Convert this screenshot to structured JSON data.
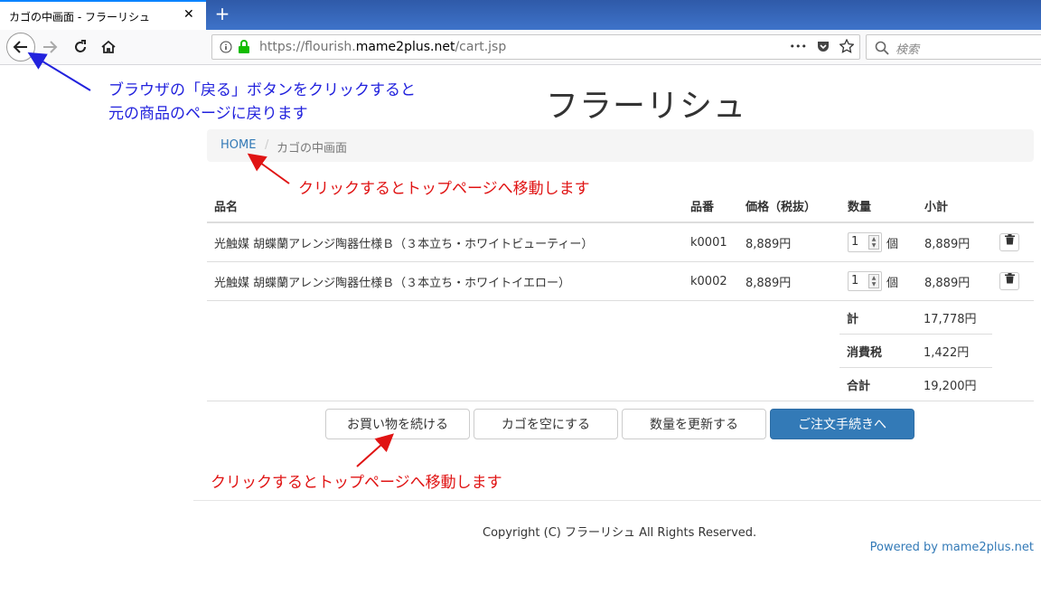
{
  "browser": {
    "tab_title": "カゴの中画面 - フラーリシュ",
    "tab_close": "✕",
    "new_tab": "+",
    "url_prefix": "https://flourish.",
    "url_domain": "mame2plus.net",
    "url_path": "/cart.jsp",
    "search_placeholder": "検索",
    "menu_dots": "•••"
  },
  "site": {
    "title": "フラーリシュ"
  },
  "breadcrumb": {
    "home": "HOME",
    "sep": "/",
    "current": "カゴの中画面"
  },
  "cart": {
    "headers": [
      "品名",
      "品番",
      "価格（税抜）",
      "数量",
      "小計"
    ],
    "rows": [
      {
        "name": "光触媒 胡蝶蘭アレンジ陶器仕様Ｂ（３本立ち・ホワイトビューティー）",
        "code": "k0001",
        "price": "8,889円",
        "qty": "1",
        "unit": "個",
        "subtotal": "8,889円"
      },
      {
        "name": "光触媒 胡蝶蘭アレンジ陶器仕様Ｂ（３本立ち・ホワイトイエロー）",
        "code": "k0002",
        "price": "8,889円",
        "qty": "1",
        "unit": "個",
        "subtotal": "8,889円"
      }
    ],
    "summary": [
      {
        "label": "計",
        "value": "17,778円"
      },
      {
        "label": "消費税",
        "value": "1,422円"
      },
      {
        "label": "合計",
        "value": "19,200円"
      }
    ]
  },
  "buttons": {
    "continue": "お買い物を続ける",
    "empty": "カゴを空にする",
    "update": "数量を更新する",
    "checkout": "ご注文手続きへ"
  },
  "footer": {
    "copyright": "Copyright (C) フラーリシュ All Rights Reserved.",
    "powered": "Powered by mame2plus.net"
  },
  "annotations": {
    "back_line1": "ブラウザの「戻る」ボタンをクリックすると",
    "back_line2": "元の商品のページに戻ります",
    "home_note": "クリックするとトップページへ移動します",
    "continue_note": "クリックするとトップページへ移動します"
  },
  "colors": {
    "annotation_blue": "#2222dd",
    "annotation_red": "#e01414",
    "primary": "#337ab7"
  }
}
